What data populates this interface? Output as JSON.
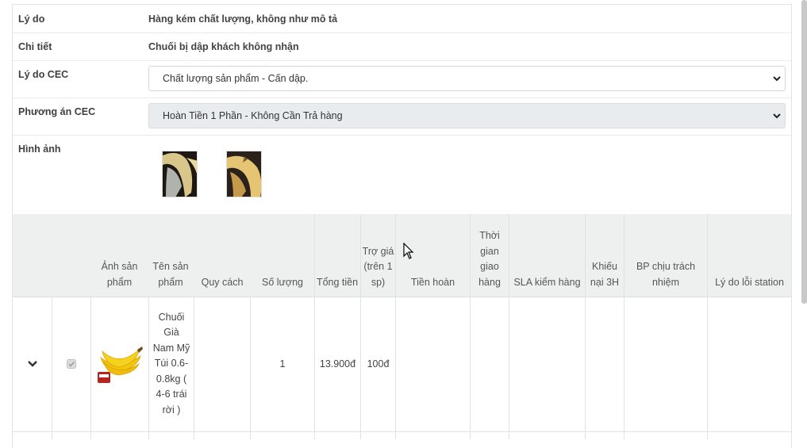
{
  "details": {
    "reason_label": "Lý do",
    "reason_value": "Hàng kém chất lượng, không như mô tả",
    "detail_label": "Chi tiết",
    "detail_value": "Chuối bị dập khách không nhận",
    "cec_reason_label": "Lý do CEC",
    "cec_reason_selected": "Chất lượng sản phẩm - Cấn dập.",
    "cec_option_label": "Phương án CEC",
    "cec_option_selected": "Hoàn Tiền 1 Phần - Không Cần Trả hàng",
    "images_label": "Hình ảnh"
  },
  "table": {
    "headers": {
      "product_image": "Ảnh sản phẩm",
      "product_name": "Tên sản phẩm",
      "spec": "Quy cách",
      "quantity": "Số lượng",
      "total": "Tổng tiền",
      "subsidy": "Trợ giá (trên 1 sp)",
      "refund": "Tiền hoàn",
      "delivery_time": "Thời gian giao hàng",
      "sla_check": "SLA kiểm hàng",
      "complaint_3h": "Khiếu nại 3H",
      "responsible_dept": "BP chịu trách nhiệm",
      "station_error_reason": "Lý do lỗi station"
    },
    "rows": [
      {
        "product_name": "Chuối Già Nam Mỹ Túi 0.6-0.8kg ( 4-6 trái rời )",
        "spec": "",
        "quantity": "1",
        "total": "13.900đ",
        "subsidy": "100đ",
        "refund": "",
        "delivery_time": "",
        "sla_check": "",
        "complaint_3h": "",
        "responsible_dept": "",
        "station_error_reason": "",
        "checked": true,
        "checkbox_disabled": true
      }
    ]
  },
  "colors": {
    "header_bg": "#eef0f0",
    "select_disabled_bg": "#e9ecef",
    "banana_yellow": "#f2c511"
  }
}
